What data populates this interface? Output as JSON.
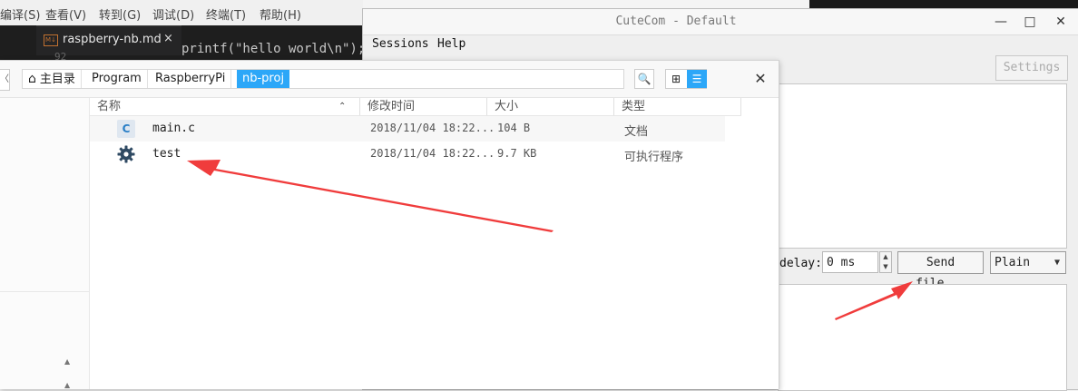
{
  "background_editor": {
    "menu_items": [
      "编译(S)",
      "查看(V)",
      "转到(G)",
      "调试(D)",
      "终端(T)",
      "帮助(H)"
    ],
    "tab_name": "raspberry-nb.md",
    "tab_icon_text": "M↓",
    "tab_close": "×",
    "line_number": "92",
    "code_snippet": "printf(\"hello world\\n\");"
  },
  "cutecom": {
    "title": "CuteCom - Default",
    "window_buttons": {
      "minimize": "—",
      "maximize": "□",
      "close": "✕"
    },
    "menu": [
      "Sessions",
      "Help"
    ],
    "settings_label": "Settings",
    "delay_label": "delay:",
    "delay_value": "0 ms",
    "send_file_label": "Send file...",
    "format_value": "Plain",
    "spinner_up": "▲",
    "spinner_down": "▼",
    "dropdown_arrow": "▼"
  },
  "file_manager": {
    "back_icon": "〈",
    "breadcrumb": [
      {
        "label": "主目录",
        "icon": "home-icon"
      },
      {
        "label": "Program"
      },
      {
        "label": "RaspberryPi"
      },
      {
        "label": "nb-proj",
        "selected": true
      }
    ],
    "home_glyph": "⌂",
    "search_glyph": "🔍",
    "view_icons": {
      "grid": "⊞",
      "list": "☰"
    },
    "close_glyph": "✕",
    "columns": [
      "名称",
      "修改时间",
      "大小",
      "类型"
    ],
    "sort_arrow": "⌃",
    "files": [
      {
        "name": "main.c",
        "modified": "2018/11/04 18:22...",
        "size": "104 B",
        "type": "文档",
        "icon": "c-source-file-icon",
        "icon_text": "C"
      },
      {
        "name": "test",
        "modified": "2018/11/04 18:22...",
        "size": "9.7 KB",
        "type": "可执行程序",
        "icon": "gear-icon",
        "icon_text": "⚙"
      }
    ],
    "sidebar_up_arrow": "▲"
  },
  "colors": {
    "accent": "#2ca7f8",
    "annotation_arrow": "#f03c3c",
    "editor_bg": "#1e1e1e"
  }
}
